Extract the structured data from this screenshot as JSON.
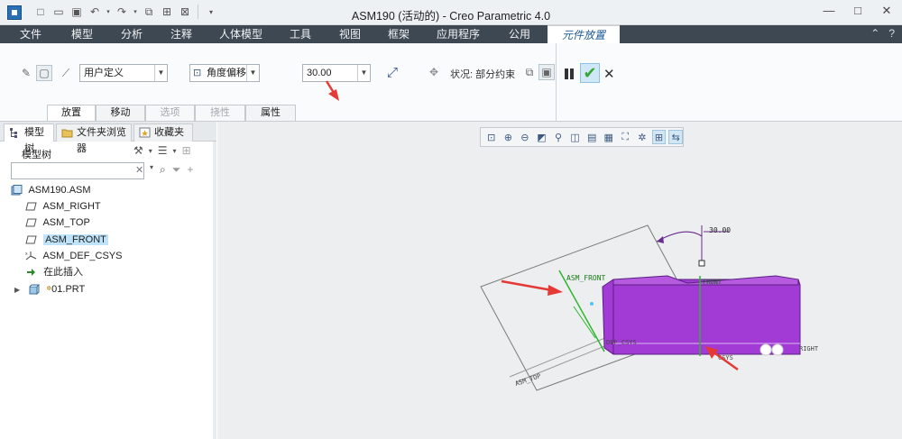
{
  "window": {
    "title": "ASM190 (活动的) - Creo Parametric 4.0"
  },
  "ribbon_tabs": [
    {
      "label": "文件"
    },
    {
      "label": "模型"
    },
    {
      "label": "分析"
    },
    {
      "label": "注释"
    },
    {
      "label": "人体模型"
    },
    {
      "label": "工具"
    },
    {
      "label": "视图"
    },
    {
      "label": "框架"
    },
    {
      "label": "应用程序"
    },
    {
      "label": "公用"
    },
    {
      "label": "元件放置"
    }
  ],
  "ribbon": {
    "constraint_set": "用户定义",
    "constraint_type": "角度偏移",
    "offset_value": "30.00",
    "status": "状况: 部分约束"
  },
  "sub_tabs": [
    {
      "label": "放置",
      "state": "selected"
    },
    {
      "label": "移动",
      "state": "normal"
    },
    {
      "label": "选项",
      "state": "disabled"
    },
    {
      "label": "挠性",
      "state": "disabled"
    },
    {
      "label": "属性",
      "state": "normal"
    }
  ],
  "panel": {
    "tabs": [
      {
        "label": "模型树"
      },
      {
        "label": "文件夹浏览器"
      },
      {
        "label": "收藏夹"
      }
    ],
    "tree_header": "模型树",
    "search_placeholder": ""
  },
  "tree": [
    {
      "label": "ASM190.ASM",
      "icon": "assembly-icon"
    },
    {
      "label": "ASM_RIGHT",
      "icon": "datum-plane-icon"
    },
    {
      "label": "ASM_TOP",
      "icon": "datum-plane-icon"
    },
    {
      "label": "ASM_FRONT",
      "icon": "datum-plane-icon"
    },
    {
      "label": "ASM_DEF_CSYS",
      "icon": "csys-icon"
    },
    {
      "label": "在此插入",
      "icon": "insert-arrow-icon"
    },
    {
      "label": "01.PRT",
      "icon": "part-icon"
    }
  ],
  "scene": {
    "dimension_label": "30.00",
    "labels": {
      "asm_front": "ASM_FRONT",
      "front": "FRONT",
      "def_csys": "DEF_CSYS",
      "asm_top": "ASM_TOP",
      "right": "RIGHT",
      "csys": "CSYS"
    },
    "colors": {
      "part": "#a23bd6",
      "datum_green": "#2db52d",
      "accent_red": "#e53935",
      "dim_line": "#6a2c8e"
    }
  }
}
